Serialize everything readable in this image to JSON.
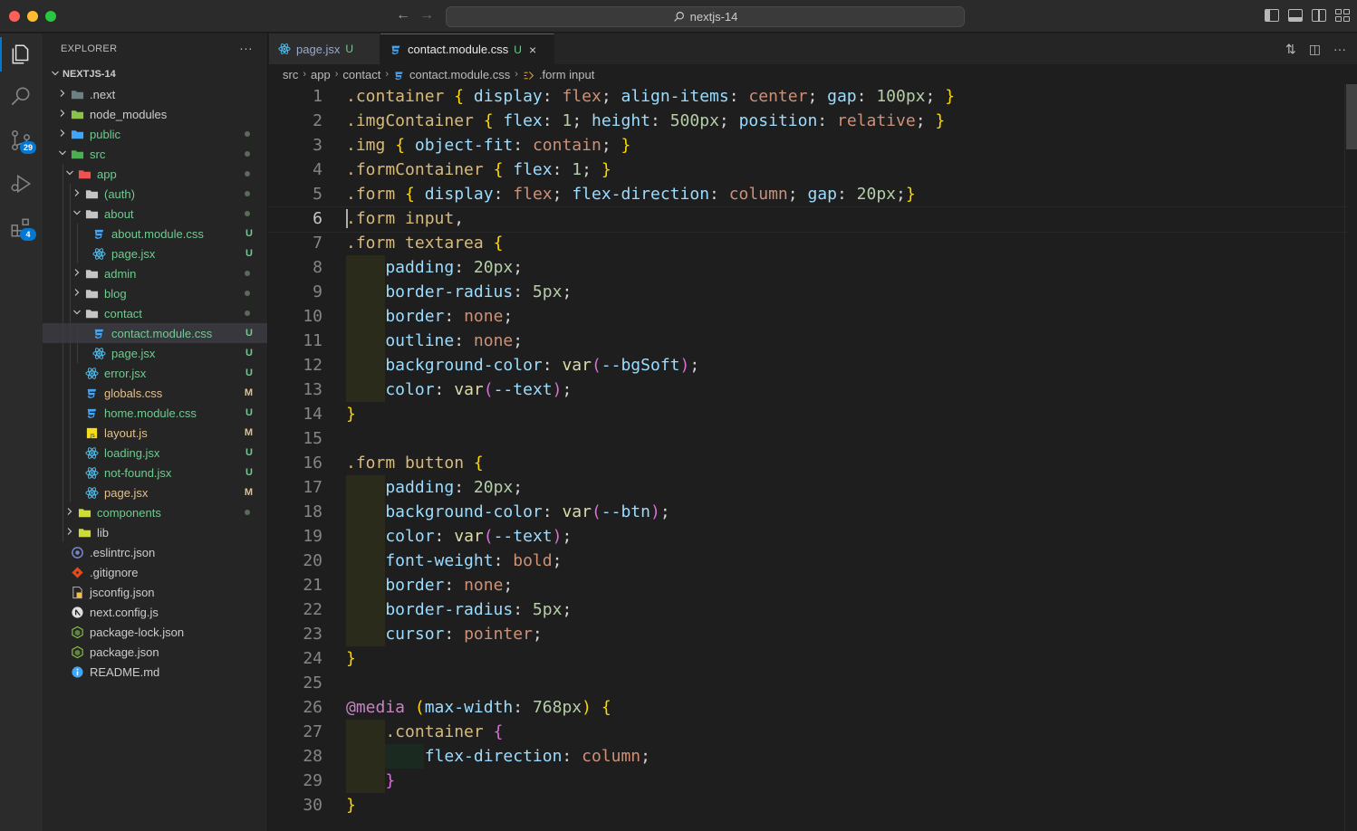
{
  "window": {
    "search_text": "nextjs-14"
  },
  "activity": {
    "scm_badge": "29",
    "extensions_badge": "4"
  },
  "explorer": {
    "title": "EXPLORER",
    "more": "···",
    "root": "NEXTJS-14",
    "rows": [
      {
        "name": ".next",
        "depth": 0,
        "kind": "folder",
        "open": false,
        "color": "#6d8086",
        "status": "",
        "status_color": ""
      },
      {
        "name": "node_modules",
        "depth": 0,
        "kind": "folder",
        "open": false,
        "color": "#8bc34a",
        "status": "",
        "status_color": ""
      },
      {
        "name": "public",
        "depth": 0,
        "kind": "folder",
        "open": false,
        "color": "#42a5f5",
        "status": "dot",
        "status_color": "#5a6b5a"
      },
      {
        "name": "src",
        "depth": 0,
        "kind": "folder",
        "open": true,
        "color": "#4caf50",
        "status": "dot",
        "status_color": "#5a6b5a"
      },
      {
        "name": "app",
        "depth": 1,
        "kind": "folder",
        "open": true,
        "color": "#ef5350",
        "status": "dot",
        "status_color": "#5a6b5a"
      },
      {
        "name": "(auth)",
        "depth": 2,
        "kind": "folder",
        "open": false,
        "color": "#c5c5c5",
        "status": "dot",
        "status_color": "#5a6b5a"
      },
      {
        "name": "about",
        "depth": 2,
        "kind": "folder",
        "open": true,
        "color": "#c5c5c5",
        "status": "dot",
        "status_color": "#5a6b5a"
      },
      {
        "name": "about.module.css",
        "depth": 3,
        "kind": "css",
        "open": false,
        "color": "#42a5f5",
        "status": "U",
        "status_color": "#73c991"
      },
      {
        "name": "page.jsx",
        "depth": 3,
        "kind": "react",
        "open": false,
        "color": "#4fc3f7",
        "status": "U",
        "status_color": "#73c991"
      },
      {
        "name": "admin",
        "depth": 2,
        "kind": "folder",
        "open": false,
        "color": "#c5c5c5",
        "status": "dot",
        "status_color": "#5a6b5a"
      },
      {
        "name": "blog",
        "depth": 2,
        "kind": "folder",
        "open": false,
        "color": "#c5c5c5",
        "status": "dot",
        "status_color": "#5a6b5a"
      },
      {
        "name": "contact",
        "depth": 2,
        "kind": "folder",
        "open": true,
        "color": "#c5c5c5",
        "status": "dot",
        "status_color": "#5a6b5a"
      },
      {
        "name": "contact.module.css",
        "depth": 3,
        "kind": "css",
        "open": false,
        "color": "#42a5f5",
        "status": "U",
        "status_color": "#73c991",
        "selected": true
      },
      {
        "name": "page.jsx",
        "depth": 3,
        "kind": "react",
        "open": false,
        "color": "#4fc3f7",
        "status": "U",
        "status_color": "#73c991"
      },
      {
        "name": "error.jsx",
        "depth": 2,
        "kind": "react",
        "open": false,
        "color": "#4fc3f7",
        "status": "U",
        "status_color": "#73c991"
      },
      {
        "name": "globals.css",
        "depth": 2,
        "kind": "css",
        "open": false,
        "color": "#42a5f5",
        "status": "M",
        "status_color": "#e2c08d"
      },
      {
        "name": "home.module.css",
        "depth": 2,
        "kind": "css",
        "open": false,
        "color": "#42a5f5",
        "status": "U",
        "status_color": "#73c991"
      },
      {
        "name": "layout.js",
        "depth": 2,
        "kind": "js",
        "open": false,
        "color": "#e2c08d",
        "status": "M",
        "status_color": "#e2c08d"
      },
      {
        "name": "loading.jsx",
        "depth": 2,
        "kind": "react",
        "open": false,
        "color": "#4fc3f7",
        "status": "U",
        "status_color": "#73c991"
      },
      {
        "name": "not-found.jsx",
        "depth": 2,
        "kind": "react",
        "open": false,
        "color": "#4fc3f7",
        "status": "U",
        "status_color": "#73c991"
      },
      {
        "name": "page.jsx",
        "depth": 2,
        "kind": "react",
        "open": false,
        "color": "#4fc3f7",
        "status": "M",
        "status_color": "#e2c08d"
      },
      {
        "name": "components",
        "depth": 1,
        "kind": "folder",
        "open": false,
        "color": "#cddc39",
        "status": "dot",
        "status_color": "#5a6b5a"
      },
      {
        "name": "lib",
        "depth": 1,
        "kind": "folder",
        "open": false,
        "color": "#cddc39",
        "status": "",
        "status_color": ""
      },
      {
        "name": ".eslintrc.json",
        "depth": 0,
        "kind": "eslint",
        "open": false,
        "color": "#7986cb",
        "status": "",
        "status_color": ""
      },
      {
        "name": ".gitignore",
        "depth": 0,
        "kind": "git",
        "open": false,
        "color": "#e64a19",
        "status": "",
        "status_color": ""
      },
      {
        "name": "jsconfig.json",
        "depth": 0,
        "kind": "jsconfig",
        "open": false,
        "color": "#fbc02d",
        "status": "",
        "status_color": ""
      },
      {
        "name": "next.config.js",
        "depth": 0,
        "kind": "next",
        "open": false,
        "color": "#e0e0e0",
        "status": "",
        "status_color": ""
      },
      {
        "name": "package-lock.json",
        "depth": 0,
        "kind": "npm",
        "open": false,
        "color": "#8bc34a",
        "status": "",
        "status_color": ""
      },
      {
        "name": "package.json",
        "depth": 0,
        "kind": "npm",
        "open": false,
        "color": "#8bc34a",
        "status": "",
        "status_color": ""
      },
      {
        "name": "README.md",
        "depth": 0,
        "kind": "info",
        "open": false,
        "color": "#42a5f5",
        "status": "",
        "status_color": ""
      }
    ]
  },
  "tabs": [
    {
      "label": "page.jsx",
      "status": "U"
    },
    {
      "label": "contact.module.css",
      "status": "U",
      "close": "×"
    }
  ],
  "breadcrumb": {
    "parts": [
      "src",
      "app",
      "contact",
      "contact.module.css",
      ".form input"
    ],
    "sep": "›"
  },
  "editor": {
    "current_line": 6,
    "lines": [
      [
        [
          "sel",
          ".container"
        ],
        [
          "punc",
          " "
        ],
        [
          "brace1",
          "{"
        ],
        [
          "punc",
          " "
        ],
        [
          "prop",
          "display"
        ],
        [
          "punc",
          ": "
        ],
        [
          "val",
          "flex"
        ],
        [
          "punc",
          "; "
        ],
        [
          "prop",
          "align-items"
        ],
        [
          "punc",
          ": "
        ],
        [
          "val",
          "center"
        ],
        [
          "punc",
          "; "
        ],
        [
          "prop",
          "gap"
        ],
        [
          "punc",
          ": "
        ],
        [
          "num",
          "100px"
        ],
        [
          "punc",
          "; "
        ],
        [
          "brace1",
          "}"
        ]
      ],
      [
        [
          "sel",
          ".imgContainer"
        ],
        [
          "punc",
          " "
        ],
        [
          "brace1",
          "{"
        ],
        [
          "punc",
          " "
        ],
        [
          "prop",
          "flex"
        ],
        [
          "punc",
          ": "
        ],
        [
          "num",
          "1"
        ],
        [
          "punc",
          "; "
        ],
        [
          "prop",
          "height"
        ],
        [
          "punc",
          ": "
        ],
        [
          "num",
          "500px"
        ],
        [
          "punc",
          "; "
        ],
        [
          "prop",
          "position"
        ],
        [
          "punc",
          ": "
        ],
        [
          "val",
          "relative"
        ],
        [
          "punc",
          "; "
        ],
        [
          "brace1",
          "}"
        ]
      ],
      [
        [
          "sel",
          ".img"
        ],
        [
          "punc",
          " "
        ],
        [
          "brace1",
          "{"
        ],
        [
          "punc",
          " "
        ],
        [
          "prop",
          "object-fit"
        ],
        [
          "punc",
          ": "
        ],
        [
          "val",
          "contain"
        ],
        [
          "punc",
          "; "
        ],
        [
          "brace1",
          "}"
        ]
      ],
      [
        [
          "sel",
          ".formContainer"
        ],
        [
          "punc",
          " "
        ],
        [
          "brace1",
          "{"
        ],
        [
          "punc",
          " "
        ],
        [
          "prop",
          "flex"
        ],
        [
          "punc",
          ": "
        ],
        [
          "num",
          "1"
        ],
        [
          "punc",
          "; "
        ],
        [
          "brace1",
          "}"
        ]
      ],
      [
        [
          "sel",
          ".form"
        ],
        [
          "punc",
          " "
        ],
        [
          "brace1",
          "{"
        ],
        [
          "punc",
          " "
        ],
        [
          "prop",
          "display"
        ],
        [
          "punc",
          ": "
        ],
        [
          "val",
          "flex"
        ],
        [
          "punc",
          "; "
        ],
        [
          "prop",
          "flex-direction"
        ],
        [
          "punc",
          ": "
        ],
        [
          "val",
          "column"
        ],
        [
          "punc",
          "; "
        ],
        [
          "prop",
          "gap"
        ],
        [
          "punc",
          ": "
        ],
        [
          "num",
          "20px"
        ],
        [
          "punc",
          ";"
        ],
        [
          "brace1",
          "}"
        ]
      ],
      [
        [
          "sel",
          ".form input"
        ],
        [
          "punc",
          ","
        ]
      ],
      [
        [
          "sel",
          ".form textarea"
        ],
        [
          "punc",
          " "
        ],
        [
          "brace1",
          "{"
        ]
      ],
      [
        [
          "i1",
          ""
        ],
        [
          "prop",
          "    padding"
        ],
        [
          "punc",
          ": "
        ],
        [
          "num",
          "20px"
        ],
        [
          "punc",
          ";"
        ]
      ],
      [
        [
          "i1",
          ""
        ],
        [
          "prop",
          "    border-radius"
        ],
        [
          "punc",
          ": "
        ],
        [
          "num",
          "5px"
        ],
        [
          "punc",
          ";"
        ]
      ],
      [
        [
          "i1",
          ""
        ],
        [
          "prop",
          "    border"
        ],
        [
          "punc",
          ": "
        ],
        [
          "val",
          "none"
        ],
        [
          "punc",
          ";"
        ]
      ],
      [
        [
          "i1",
          ""
        ],
        [
          "prop",
          "    outline"
        ],
        [
          "punc",
          ": "
        ],
        [
          "val",
          "none"
        ],
        [
          "punc",
          ";"
        ]
      ],
      [
        [
          "i1",
          ""
        ],
        [
          "prop",
          "    background-color"
        ],
        [
          "punc",
          ": "
        ],
        [
          "fn",
          "var"
        ],
        [
          "brace2",
          "("
        ],
        [
          "varname",
          "--bgSoft"
        ],
        [
          "brace2",
          ")"
        ],
        [
          "punc",
          ";"
        ]
      ],
      [
        [
          "i1",
          ""
        ],
        [
          "prop",
          "    color"
        ],
        [
          "punc",
          ": "
        ],
        [
          "fn",
          "var"
        ],
        [
          "brace2",
          "("
        ],
        [
          "varname",
          "--text"
        ],
        [
          "brace2",
          ")"
        ],
        [
          "punc",
          ";"
        ]
      ],
      [
        [
          "brace1",
          "}"
        ]
      ],
      [],
      [
        [
          "sel",
          ".form button"
        ],
        [
          "punc",
          " "
        ],
        [
          "brace1",
          "{"
        ]
      ],
      [
        [
          "i1",
          ""
        ],
        [
          "prop",
          "    padding"
        ],
        [
          "punc",
          ": "
        ],
        [
          "num",
          "20px"
        ],
        [
          "punc",
          ";"
        ]
      ],
      [
        [
          "i1",
          ""
        ],
        [
          "prop",
          "    background-color"
        ],
        [
          "punc",
          ": "
        ],
        [
          "fn",
          "var"
        ],
        [
          "brace2",
          "("
        ],
        [
          "varname",
          "--btn"
        ],
        [
          "brace2",
          ")"
        ],
        [
          "punc",
          ";"
        ]
      ],
      [
        [
          "i1",
          ""
        ],
        [
          "prop",
          "    color"
        ],
        [
          "punc",
          ": "
        ],
        [
          "fn",
          "var"
        ],
        [
          "brace2",
          "("
        ],
        [
          "varname",
          "--text"
        ],
        [
          "brace2",
          ")"
        ],
        [
          "punc",
          ";"
        ]
      ],
      [
        [
          "i1",
          ""
        ],
        [
          "prop",
          "    font-weight"
        ],
        [
          "punc",
          ": "
        ],
        [
          "val",
          "bold"
        ],
        [
          "punc",
          ";"
        ]
      ],
      [
        [
          "i1",
          ""
        ],
        [
          "prop",
          "    border"
        ],
        [
          "punc",
          ": "
        ],
        [
          "val",
          "none"
        ],
        [
          "punc",
          ";"
        ]
      ],
      [
        [
          "i1",
          ""
        ],
        [
          "prop",
          "    border-radius"
        ],
        [
          "punc",
          ": "
        ],
        [
          "num",
          "5px"
        ],
        [
          "punc",
          ";"
        ]
      ],
      [
        [
          "i1",
          ""
        ],
        [
          "prop",
          "    cursor"
        ],
        [
          "punc",
          ": "
        ],
        [
          "val",
          "pointer"
        ],
        [
          "punc",
          ";"
        ]
      ],
      [
        [
          "brace1",
          "}"
        ]
      ],
      [],
      [
        [
          "at",
          "@media"
        ],
        [
          "punc",
          " "
        ],
        [
          "brace1",
          "("
        ],
        [
          "prop",
          "max-width"
        ],
        [
          "punc",
          ": "
        ],
        [
          "num",
          "768px"
        ],
        [
          "brace1",
          ")"
        ],
        [
          "punc",
          " "
        ],
        [
          "brace1",
          "{"
        ]
      ],
      [
        [
          "i1",
          ""
        ],
        [
          "sel",
          "    .container"
        ],
        [
          "punc",
          " "
        ],
        [
          "brace2",
          "{"
        ]
      ],
      [
        [
          "i1",
          ""
        ],
        [
          "i2",
          ""
        ],
        [
          "prop",
          "        flex-direction"
        ],
        [
          "punc",
          ": "
        ],
        [
          "val",
          "column"
        ],
        [
          "punc",
          ";"
        ]
      ],
      [
        [
          "i1",
          ""
        ],
        [
          "brace2",
          "    }"
        ]
      ],
      [
        [
          "brace1",
          "}"
        ]
      ]
    ]
  }
}
